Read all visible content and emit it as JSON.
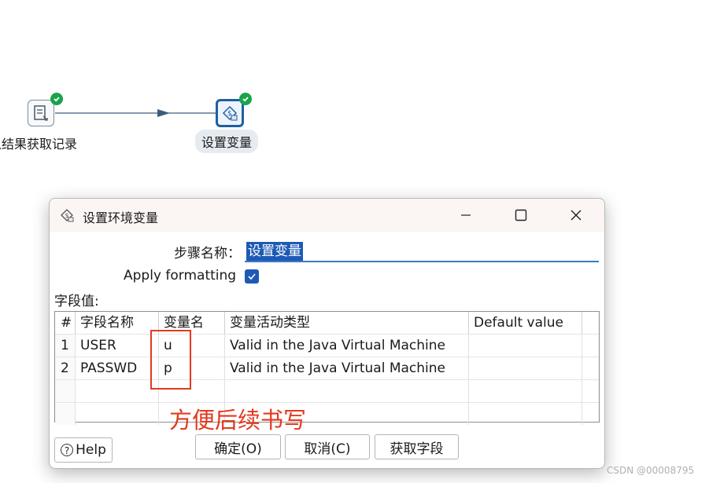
{
  "canvas": {
    "step1_label": "从结果获取记录",
    "step2_label": "设置变量"
  },
  "dialog": {
    "title": "设置环境变量",
    "step_name_label": "步骤名称：",
    "step_name_value": "设置变量",
    "apply_formatting_label": "Apply formatting",
    "apply_formatting_checked": true,
    "fields_label": "字段值:",
    "table": {
      "columns": [
        "#",
        "字段名称",
        "变量名",
        "变量活动类型",
        "Default value"
      ],
      "rows": [
        [
          "1",
          "USER",
          "u",
          "Valid in the Java Virtual Machine",
          ""
        ],
        [
          "2",
          "PASSWD",
          "p",
          "Valid in the Java Virtual Machine",
          ""
        ]
      ]
    },
    "buttons": {
      "help": "Help",
      "ok": "确定(O)",
      "cancel": "取消(C)",
      "get_fields": "获取字段"
    }
  },
  "annotation": {
    "note": "方便后续书写",
    "color": "#e23a1f"
  },
  "watermark": "CSDN @00008795",
  "colors": {
    "accent": "#1e5ab5",
    "status_ok": "#1aa34a"
  }
}
